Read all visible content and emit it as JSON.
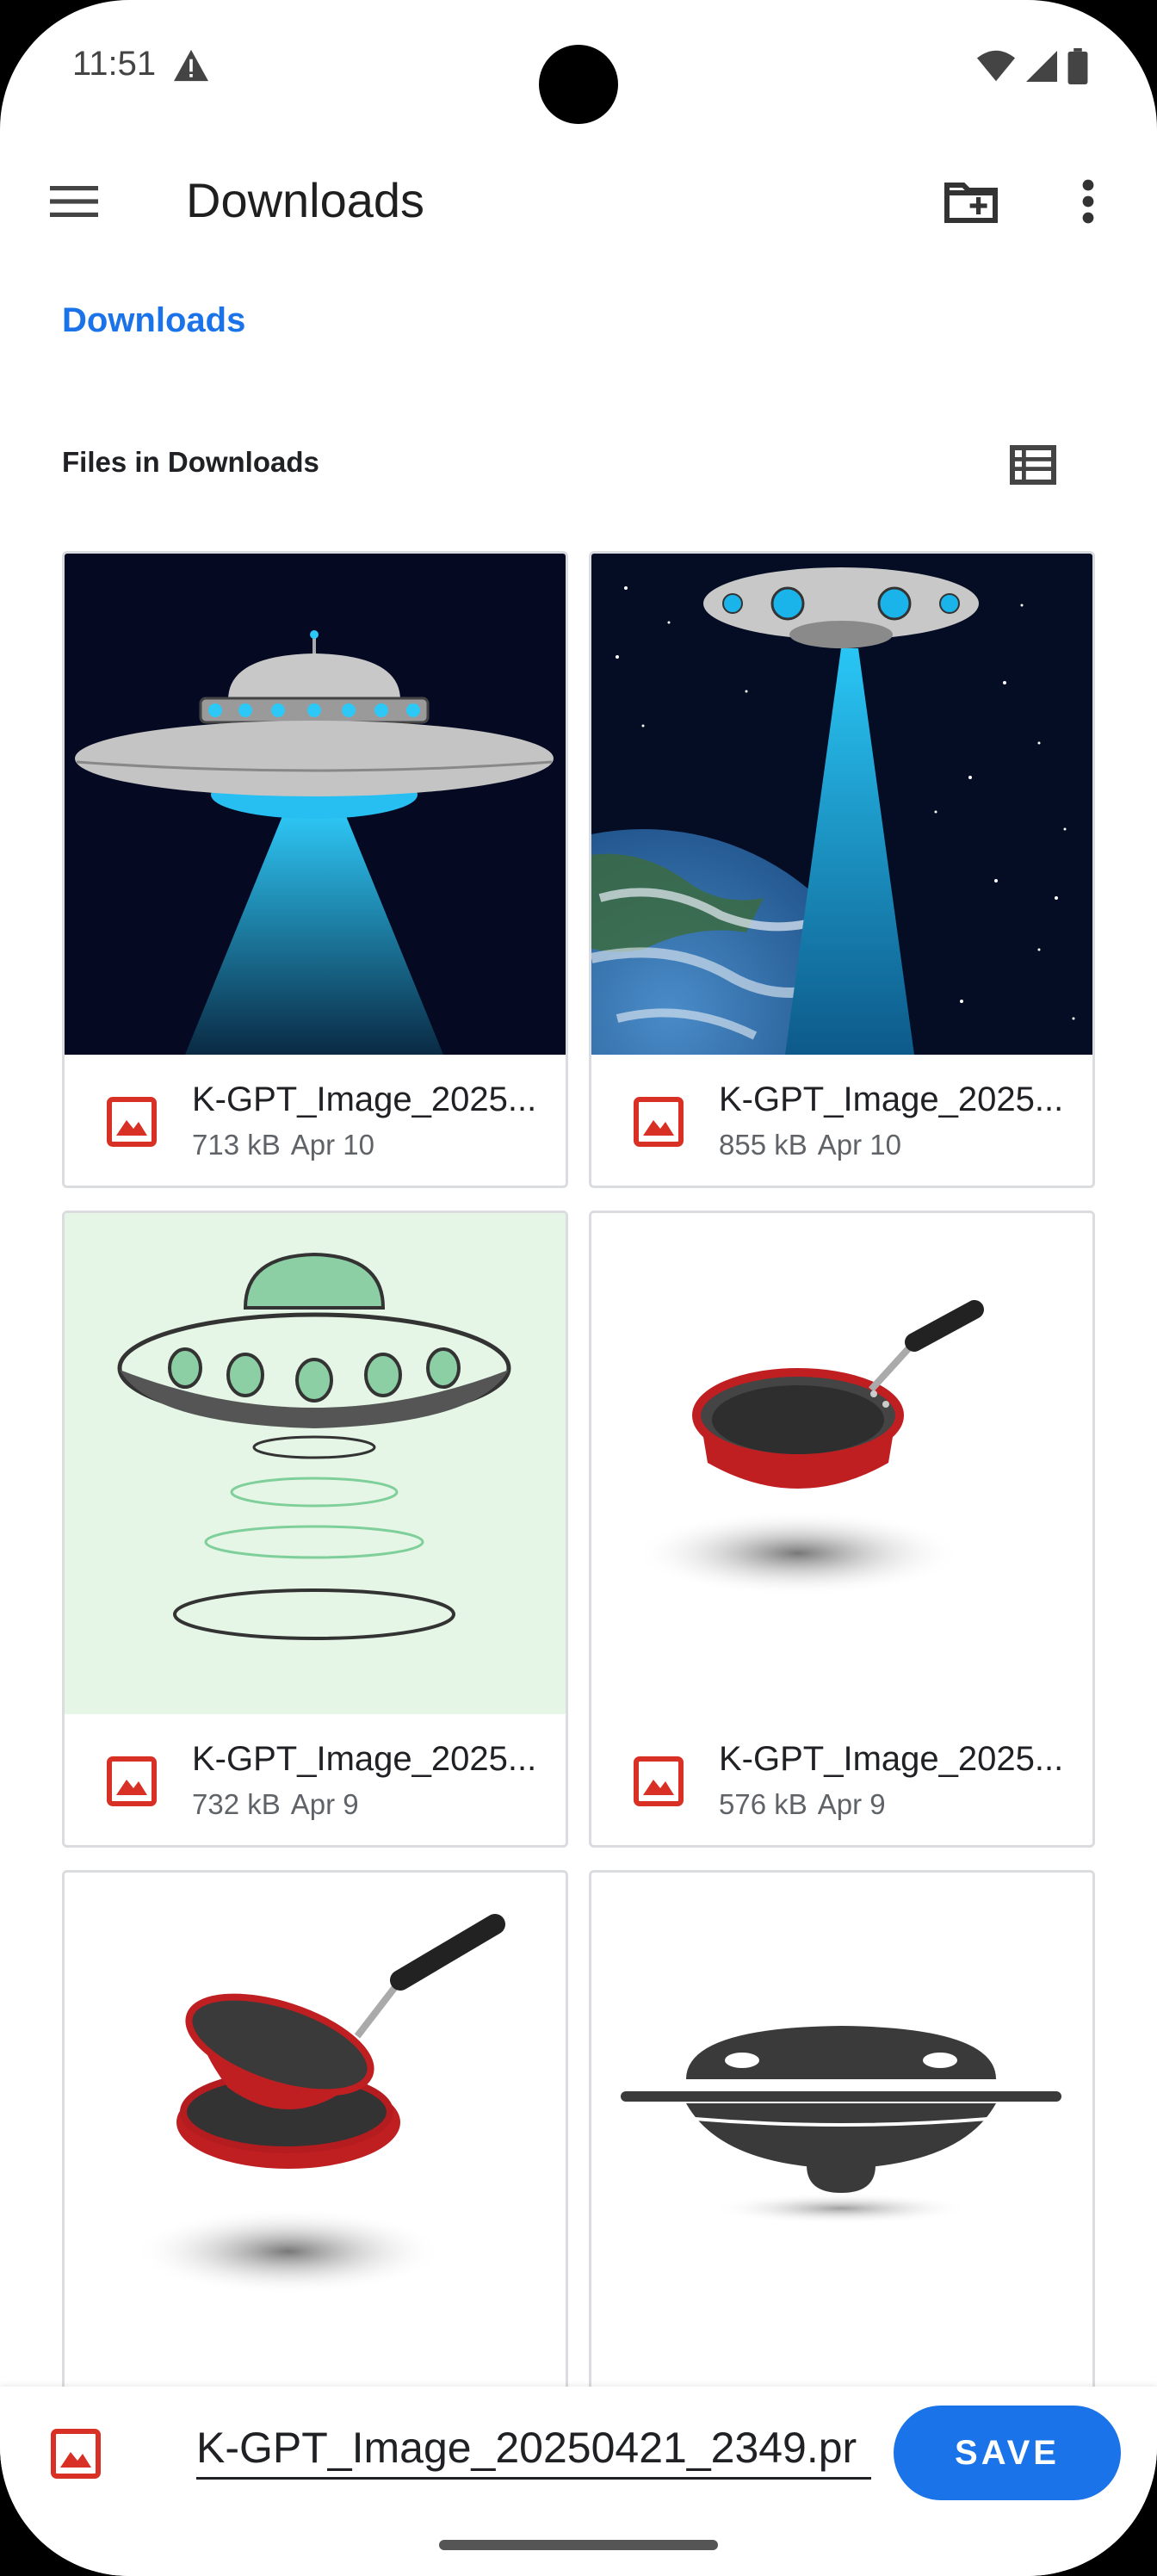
{
  "status_bar": {
    "time": "11:51"
  },
  "app_bar": {
    "title": "Downloads"
  },
  "breadcrumb": {
    "current": "Downloads"
  },
  "section": {
    "title": "Files in Downloads"
  },
  "files": [
    {
      "name": "K-GPT_Image_2025...",
      "size": "713 kB",
      "date": "Apr 10"
    },
    {
      "name": "K-GPT_Image_2025...",
      "size": "855 kB",
      "date": "Apr 10"
    },
    {
      "name": "K-GPT_Image_2025...",
      "size": "732 kB",
      "date": "Apr 9"
    },
    {
      "name": "K-GPT_Image_2025...",
      "size": "576 kB",
      "date": "Apr 9"
    }
  ],
  "bottom": {
    "filename_value": "K-GPT_Image_20250421_2349.pr",
    "save_label": "SAVE"
  },
  "colors": {
    "accent": "#1a73e8",
    "image_icon": "#d93025"
  },
  "icons": {
    "menu": "menu-icon",
    "new_folder": "create-new-folder-icon",
    "more": "more-vert-icon",
    "list_view": "list-view-icon",
    "image": "image-file-icon"
  }
}
